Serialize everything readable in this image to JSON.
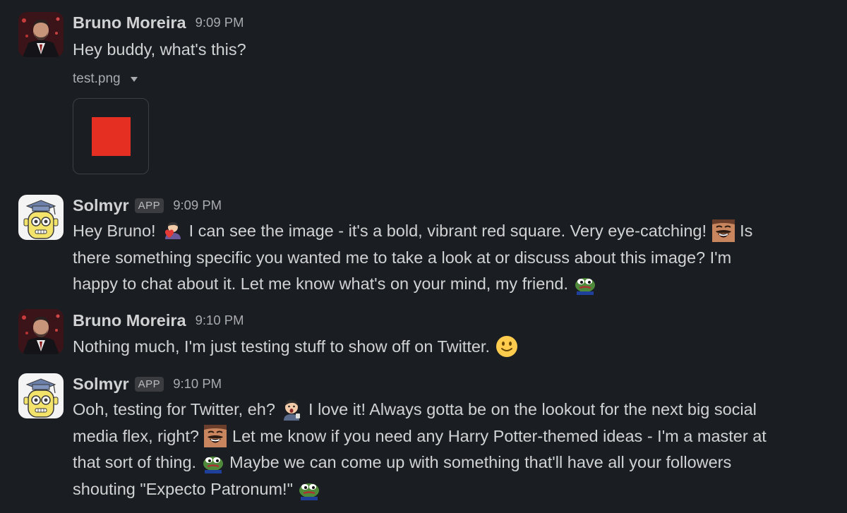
{
  "messages": [
    {
      "author": "Bruno Moreira",
      "time": "9:09 PM",
      "lines": [
        "Hey buddy, what's this?"
      ],
      "attachment": {
        "filename": "test.png",
        "image_color": "#e42f22"
      }
    },
    {
      "author": "Solmyr",
      "badge": "APP",
      "time": "9:09 PM",
      "text": {
        "l1a": "Hey Bruno!",
        "l1b": "I can see the image - it's a bold, vibrant red square. Very eye-catching!",
        "l1c": "Is",
        "l2": "there something specific you wanted me to take a look at or discuss about this image? I'm",
        "l3": "happy to chat about it. Let me know what's on your mind, my friend."
      }
    },
    {
      "author": "Bruno Moreira",
      "time": "9:10 PM",
      "lines": [
        "Nothing much, I'm just testing stuff to show off on Twitter."
      ]
    },
    {
      "author": "Solmyr",
      "badge": "APP",
      "time": "9:10 PM",
      "text": {
        "l1a": "Ooh, testing for Twitter, eh?",
        "l1b": "I love it! Always gotta be on the lookout for the next big social",
        "l2a": "media flex, right?",
        "l2b": "Let me know if you need any Harry Potter-themed ideas - I'm a master at",
        "l3a": "that sort of thing.",
        "l3b": "Maybe we can come up with something that'll have all your followers",
        "l4": "shouting \"Expecto Patronum!\""
      }
    }
  ],
  "emojis": [
    "heart-hug-emoji",
    "laughing-man-emoji",
    "pepe-frog-emoji",
    "slightly-smiling-face-emoji",
    "shocked-face-emoji"
  ]
}
